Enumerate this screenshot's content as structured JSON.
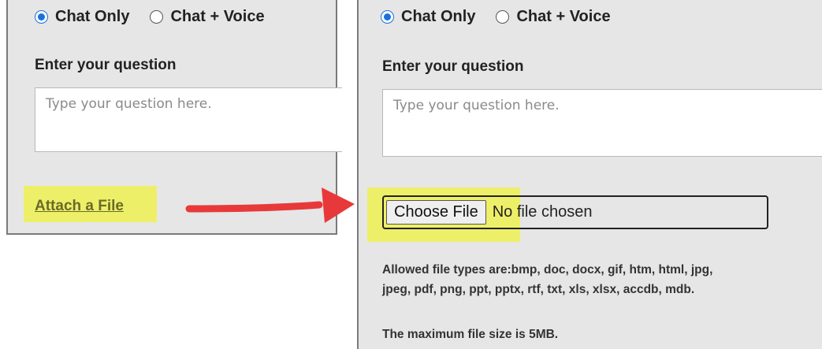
{
  "left_panel": {
    "mode_options": [
      {
        "label": "Chat Only",
        "selected": true
      },
      {
        "label": "Chat + Voice",
        "selected": false
      }
    ],
    "question_heading": "Enter your question",
    "question_placeholder": "Type your question here.",
    "attach_link": "Attach a File"
  },
  "right_panel": {
    "mode_options": [
      {
        "label": "Chat Only",
        "selected": true
      },
      {
        "label": "Chat + Voice",
        "selected": false
      }
    ],
    "question_heading": "Enter your question",
    "question_placeholder": "Type your question here.",
    "choose_file_button": "Choose File",
    "file_status": "No file chosen",
    "allowed_types_line1": "Allowed file types are:bmp, doc, docx, gif, htm, html, jpg,",
    "allowed_types_line2": "jpeg, pdf, png, ppt, pptx, rtf, txt, xls, xlsx, accdb, mdb.",
    "max_size_note": "The maximum file size is 5MB."
  },
  "colors": {
    "highlight": "#eef05a",
    "arrow": "#e8393a",
    "radio_selected": "#1a6fe0",
    "panel_bg": "#e6e6e6"
  }
}
